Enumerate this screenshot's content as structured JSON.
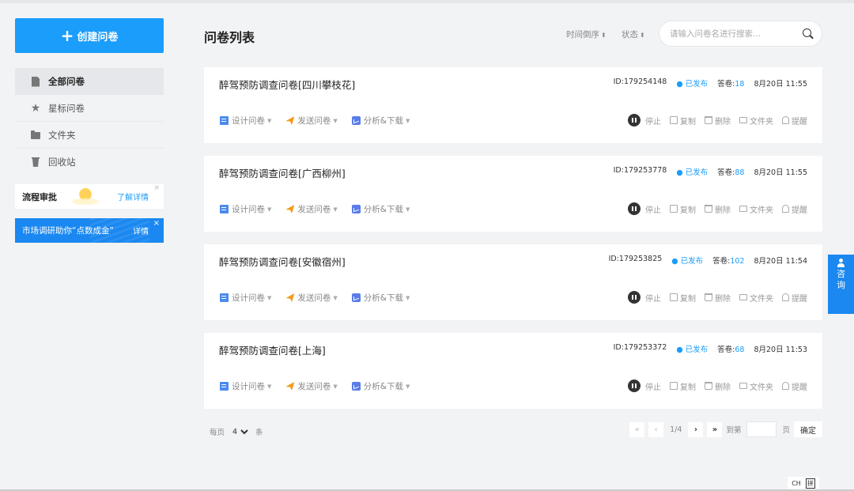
{
  "sidebar": {
    "create_label": "创建问卷",
    "nav": [
      {
        "label": "全部问卷",
        "icon": "document-icon",
        "active": true
      },
      {
        "label": "星标问卷",
        "icon": "star-icon",
        "active": false
      },
      {
        "label": "文件夹",
        "icon": "folder-icon",
        "active": false
      },
      {
        "label": "回收站",
        "icon": "trash-icon",
        "active": false
      }
    ],
    "flow_card": {
      "title": "流程审批",
      "link": "了解详情",
      "close": "×"
    },
    "market_card": {
      "title": "市场调研助你“点数成金”",
      "link": "详情",
      "close": "×"
    }
  },
  "header": {
    "title": "问卷列表",
    "sort_time": "时间倒序",
    "sort_status": "状态",
    "search_placeholder": "请输入问卷名进行搜索..."
  },
  "surveys": [
    {
      "name": "醉驾预防调查问卷[四川攀枝花]",
      "id": "ID:179254148",
      "status": "已发布",
      "answers_label": "答卷:",
      "answers": "18",
      "date": "8月20日 11:55"
    },
    {
      "name": "醉驾预防调查问卷[广西柳州]",
      "id": "ID:179253778",
      "status": "已发布",
      "answers_label": "答卷:",
      "answers": "88",
      "date": "8月20日 11:55"
    },
    {
      "name": "醉驾预防调查问卷[安徽宿州]",
      "id": "ID:179253825",
      "status": "已发布",
      "answers_label": "答卷:",
      "answers": "102",
      "date": "8月20日 11:54"
    },
    {
      "name": "醉驾预防调查问卷[上海]",
      "id": "ID:179253372",
      "status": "已发布",
      "answers_label": "答卷:",
      "answers": "68",
      "date": "8月20日 11:53"
    }
  ],
  "actions": {
    "design": "设计问卷",
    "send": "发送问卷",
    "analyze": "分析&下载"
  },
  "tools": {
    "stop": "停止",
    "copy": "复制",
    "delete": "删除",
    "folder": "文件夹",
    "remind": "提醒"
  },
  "pager": {
    "per_page_label": "每页",
    "per_page_value": "4",
    "per_page_unit": "条",
    "first": "«",
    "prev": "‹",
    "page_info": "1/4",
    "next": "›",
    "last": "»",
    "goto_label": "到第",
    "goto_unit": "页",
    "confirm": "确定"
  },
  "consult": {
    "line1": "咨",
    "line2": "询"
  },
  "ime": {
    "lang": "CH",
    "mode": "拼"
  },
  "colors": {
    "accent": "#1a9dfb",
    "sidebar_active": "#e6e7ea",
    "background": "#f2f3f5"
  }
}
